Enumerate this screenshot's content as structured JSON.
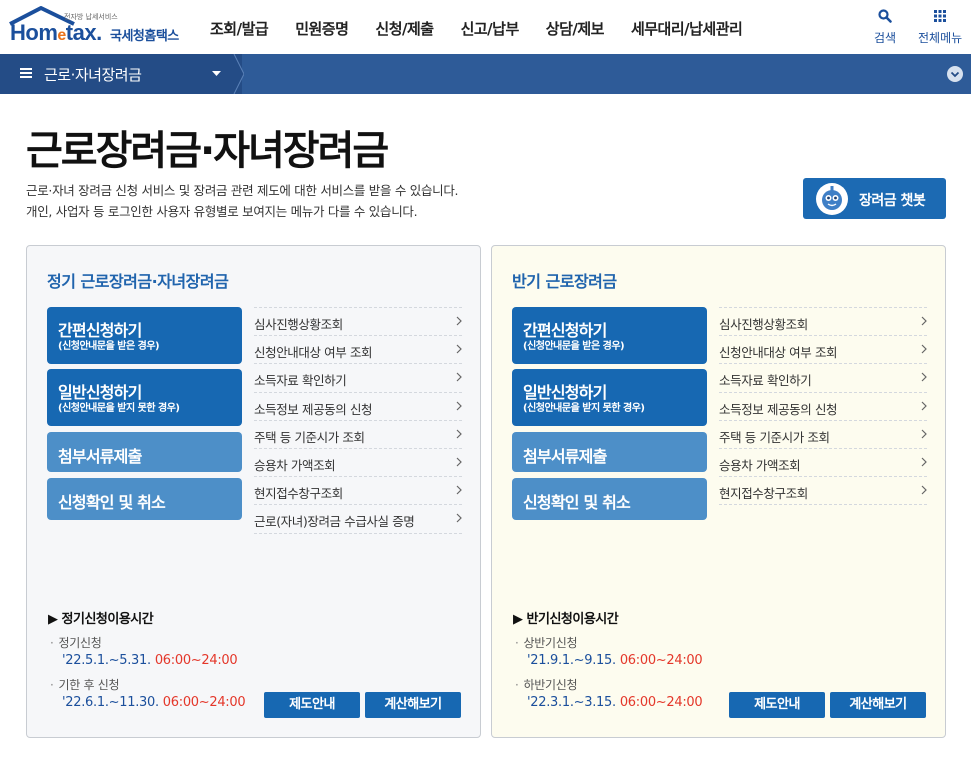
{
  "header": {
    "logo": {
      "tagline": "전자방 납세서비스",
      "word_main_1": "Hom",
      "word_e": "e",
      "word_main_2": "tax.",
      "subtitle": "국세청홈택스"
    },
    "nav": [
      "조회/발급",
      "민원증명",
      "신청/제출",
      "신고/납부",
      "상담/제보",
      "세무대리/납세관리"
    ],
    "search_label": "검색",
    "menu_label": "전체메뉴",
    "search_icon": "search-icon",
    "menu_icon": "grid-icon"
  },
  "breadcrumb": {
    "title": "근로·자녀장려금"
  },
  "page": {
    "title": "근로장려금·자녀장려금",
    "desc_line1": "근로·자녀 장려금 신청 서비스 및 장려금 관련 제도에 대한 서비스를 받을 수 있습니다.",
    "desc_line2": "개인, 사업자 등 로그인한 사용자 유형별로 보여지는 메뉴가 다를 수 있습니다.",
    "chatbot_label": "장려금 챗봇"
  },
  "panels": [
    {
      "title": "정기 근로장려금·자녀장려금",
      "buttons": [
        {
          "main": "간편신청하기",
          "sub": "(신청안내문을 받은 경우)"
        },
        {
          "main": "일반신청하기",
          "sub": "(신청안내문을 받지 못한 경우)"
        },
        {
          "main": "첨부서류제출",
          "sub": ""
        },
        {
          "main": "신청확인 및 취소",
          "sub": ""
        }
      ],
      "links": [
        "심사진행상황조회",
        "신청안내대상 여부 조회",
        "소득자료 확인하기",
        "소득정보 제공동의 신청",
        "주택 등 기준시가 조회",
        "승용차 가액조회",
        "현지접수창구조회",
        "근로(자녀)장려금 수급사실 증명"
      ],
      "time_title": "▶ 정기신청이용시간",
      "times": [
        {
          "label": "정기신청",
          "dates": "'22.5.1.~5.31.",
          "hours": "06:00~24:00"
        },
        {
          "label": "기한 후 신청",
          "dates": "'22.6.1.~11.30.",
          "hours": "06:00~24:00"
        }
      ],
      "btn_info": "제도안내",
      "btn_calc": "계산해보기"
    },
    {
      "title": "반기 근로장려금",
      "buttons": [
        {
          "main": "간편신청하기",
          "sub": "(신청안내문을 받은 경우)"
        },
        {
          "main": "일반신청하기",
          "sub": "(신청안내문을 받지 못한 경우)"
        },
        {
          "main": "첨부서류제출",
          "sub": ""
        },
        {
          "main": "신청확인 및 취소",
          "sub": ""
        }
      ],
      "links": [
        "심사진행상황조회",
        "신청안내대상 여부 조회",
        "소득자료 확인하기",
        "소득정보 제공동의 신청",
        "주택 등 기준시가 조회",
        "승용차 가액조회",
        "현지접수창구조회"
      ],
      "time_title": "▶ 반기신청이용시간",
      "times": [
        {
          "label": "상반기신청",
          "dates": "'21.9.1.~9.15.",
          "hours": "06:00~24:00"
        },
        {
          "label": "하반기신청",
          "dates": "'22.3.1.~3.15.",
          "hours": "06:00~24:00"
        }
      ],
      "btn_info": "제도안내",
      "btn_calc": "계산해보기"
    }
  ],
  "colors": {
    "brand_blue": "#1b4f9c",
    "button_dark": "#1768b2",
    "button_light": "#4d8fc8",
    "navbar": "#2e5b98",
    "hours_red": "#e4372a"
  }
}
